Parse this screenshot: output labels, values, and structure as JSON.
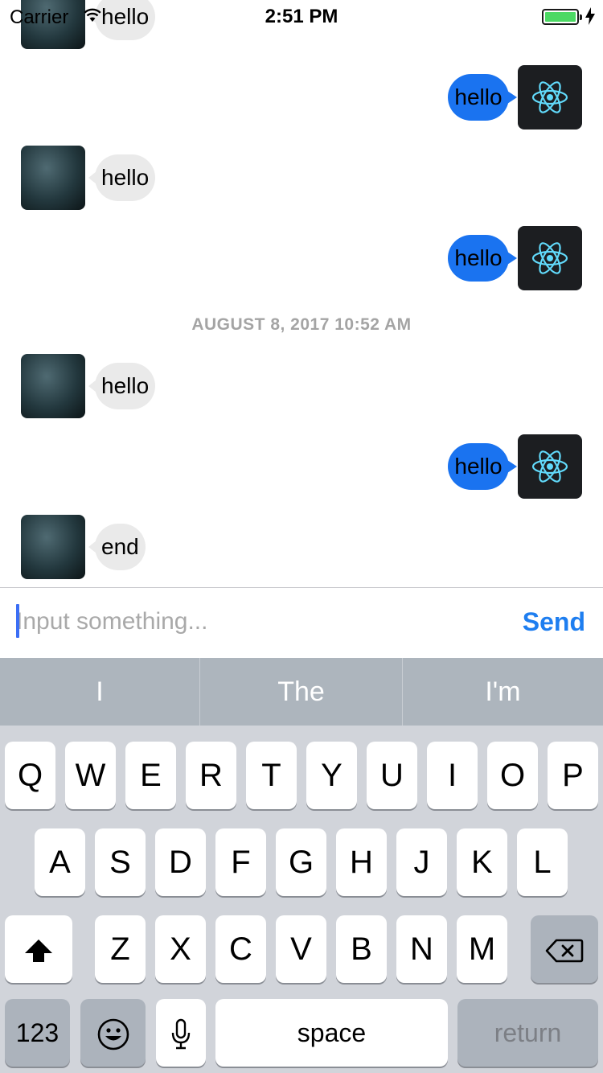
{
  "status_bar": {
    "carrier": "Carrier",
    "time": "2:51 PM",
    "battery_color": "#4cd964",
    "icons": [
      "wifi-icon",
      "battery-icon",
      "charging-bolt-icon"
    ]
  },
  "chat": {
    "timestamp": "AUGUST 8, 2017 10:52 AM",
    "messages": [
      {
        "side": "in",
        "text": "hello"
      },
      {
        "side": "out",
        "text": "hello"
      },
      {
        "side": "in",
        "text": "hello"
      },
      {
        "side": "out",
        "text": "hello"
      },
      {
        "side": "in",
        "text": "hello"
      },
      {
        "side": "out",
        "text": "hello"
      },
      {
        "side": "in",
        "text": "end"
      }
    ],
    "colors": {
      "incoming_bubble": "#eaeaea",
      "outgoing_bubble": "#1a73f0",
      "bot_avatar_bg": "#1c1e21",
      "react_logo": "#61dafb"
    }
  },
  "input_bar": {
    "placeholder": "Input something...",
    "send_label": "Send",
    "send_color": "#1e7ef0"
  },
  "keyboard": {
    "predictions": [
      "I",
      "The",
      "I'm"
    ],
    "row1": [
      "Q",
      "W",
      "E",
      "R",
      "T",
      "Y",
      "U",
      "I",
      "O",
      "P"
    ],
    "row2": [
      "A",
      "S",
      "D",
      "F",
      "G",
      "H",
      "J",
      "K",
      "L"
    ],
    "row3": [
      "Z",
      "X",
      "C",
      "V",
      "B",
      "N",
      "M"
    ],
    "numbers_label": "123",
    "space_label": "space",
    "return_label": "return",
    "icons": [
      "shift-icon",
      "delete-icon",
      "emoji-icon",
      "microphone-icon"
    ]
  }
}
